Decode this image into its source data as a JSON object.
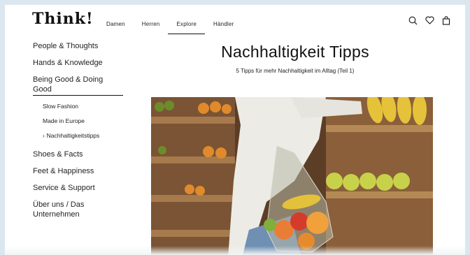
{
  "header": {
    "logo": "Think!",
    "nav": [
      "Damen",
      "Herren",
      "Explore",
      "Händler"
    ],
    "active_nav": "Explore",
    "icons": [
      "search-icon",
      "heart-icon",
      "bag-icon"
    ]
  },
  "sidebar": {
    "items_top": [
      "People & Thoughts",
      "Hands & Knowledge"
    ],
    "current": "Being Good & Doing Good",
    "sub_items": [
      "Slow Fashion",
      "Made in Europe",
      "Nachhaltigkeitstipps"
    ],
    "active_sub": "Nachhaltigkeitstipps",
    "items_bottom": [
      "Shoes & Facts",
      "Feet & Happiness",
      "Service & Support",
      "Über uns / Das Unternehmen"
    ]
  },
  "main": {
    "title": "Nachhaltigkeit Tipps",
    "subtitle": "5 Tipps für mehr Nachhaltigkeit im Alltag (Teil 1)"
  },
  "colors": {
    "frame_bg": "#dbe7ef",
    "accent": "#111111"
  }
}
